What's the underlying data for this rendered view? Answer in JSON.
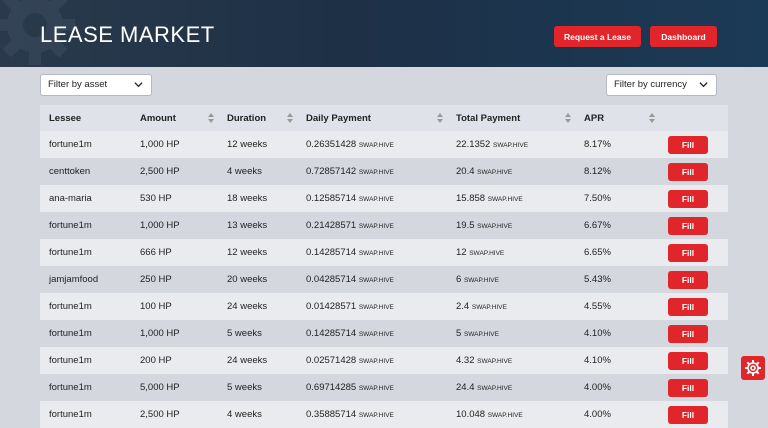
{
  "header": {
    "title": "LEASE MARKET",
    "request_label": "Request a Lease",
    "dashboard_label": "Dashboard"
  },
  "filters": {
    "asset": "Filter by asset",
    "currency": "Filter by currency"
  },
  "table": {
    "columns": [
      "Lessee",
      "Amount",
      "Duration",
      "Daily Payment",
      "Total Payment",
      "APR"
    ],
    "fill_label": "Fill",
    "rows": [
      {
        "lessee": "fortune1m",
        "amount": "1,000 HP",
        "duration": "12 weeks",
        "daily": "0.26351428",
        "daily_cur": "SWAP.HIVE",
        "total": "22.1352",
        "total_cur": "SWAP.HIVE",
        "apr": "8.17%"
      },
      {
        "lessee": "centtoken",
        "amount": "2,500 HP",
        "duration": "4 weeks",
        "daily": "0.72857142",
        "daily_cur": "SWAP.HIVE",
        "total": "20.4",
        "total_cur": "SWAP.HIVE",
        "apr": "8.12%"
      },
      {
        "lessee": "ana-maria",
        "amount": "530 HP",
        "duration": "18 weeks",
        "daily": "0.12585714",
        "daily_cur": "SWAP.HIVE",
        "total": "15.858",
        "total_cur": "SWAP.HIVE",
        "apr": "7.50%"
      },
      {
        "lessee": "fortune1m",
        "amount": "1,000 HP",
        "duration": "13 weeks",
        "daily": "0.21428571",
        "daily_cur": "SWAP.HIVE",
        "total": "19.5",
        "total_cur": "SWAP.HIVE",
        "apr": "6.67%"
      },
      {
        "lessee": "fortune1m",
        "amount": "666 HP",
        "duration": "12 weeks",
        "daily": "0.14285714",
        "daily_cur": "SWAP.HIVE",
        "total": "12",
        "total_cur": "SWAP.HIVE",
        "apr": "6.65%"
      },
      {
        "lessee": "jamjamfood",
        "amount": "250 HP",
        "duration": "20 weeks",
        "daily": "0.04285714",
        "daily_cur": "SWAP.HIVE",
        "total": "6",
        "total_cur": "SWAP.HIVE",
        "apr": "5.43%"
      },
      {
        "lessee": "fortune1m",
        "amount": "100 HP",
        "duration": "24 weeks",
        "daily": "0.01428571",
        "daily_cur": "SWAP.HIVE",
        "total": "2.4",
        "total_cur": "SWAP.HIVE",
        "apr": "4.55%"
      },
      {
        "lessee": "fortune1m",
        "amount": "1,000 HP",
        "duration": "5 weeks",
        "daily": "0.14285714",
        "daily_cur": "SWAP.HIVE",
        "total": "5",
        "total_cur": "SWAP.HIVE",
        "apr": "4.10%"
      },
      {
        "lessee": "fortune1m",
        "amount": "200 HP",
        "duration": "24 weeks",
        "daily": "0.02571428",
        "daily_cur": "SWAP.HIVE",
        "total": "4.32",
        "total_cur": "SWAP.HIVE",
        "apr": "4.10%"
      },
      {
        "lessee": "fortune1m",
        "amount": "5,000 HP",
        "duration": "5 weeks",
        "daily": "0.69714285",
        "daily_cur": "SWAP.HIVE",
        "total": "24.4",
        "total_cur": "SWAP.HIVE",
        "apr": "4.00%"
      },
      {
        "lessee": "fortune1m",
        "amount": "2,500 HP",
        "duration": "4 weeks",
        "daily": "0.35885714",
        "daily_cur": "SWAP.HIVE",
        "total": "10.048",
        "total_cur": "SWAP.HIVE",
        "apr": "4.00%"
      }
    ]
  },
  "colors": {
    "accent": "#e0262a",
    "header_bg": "#1d3046"
  },
  "icons": {
    "header_decoration": "gear-icon",
    "sort": "sort-icon",
    "dropdown": "chevron-down-icon",
    "settings": "settings-gear-icon"
  }
}
